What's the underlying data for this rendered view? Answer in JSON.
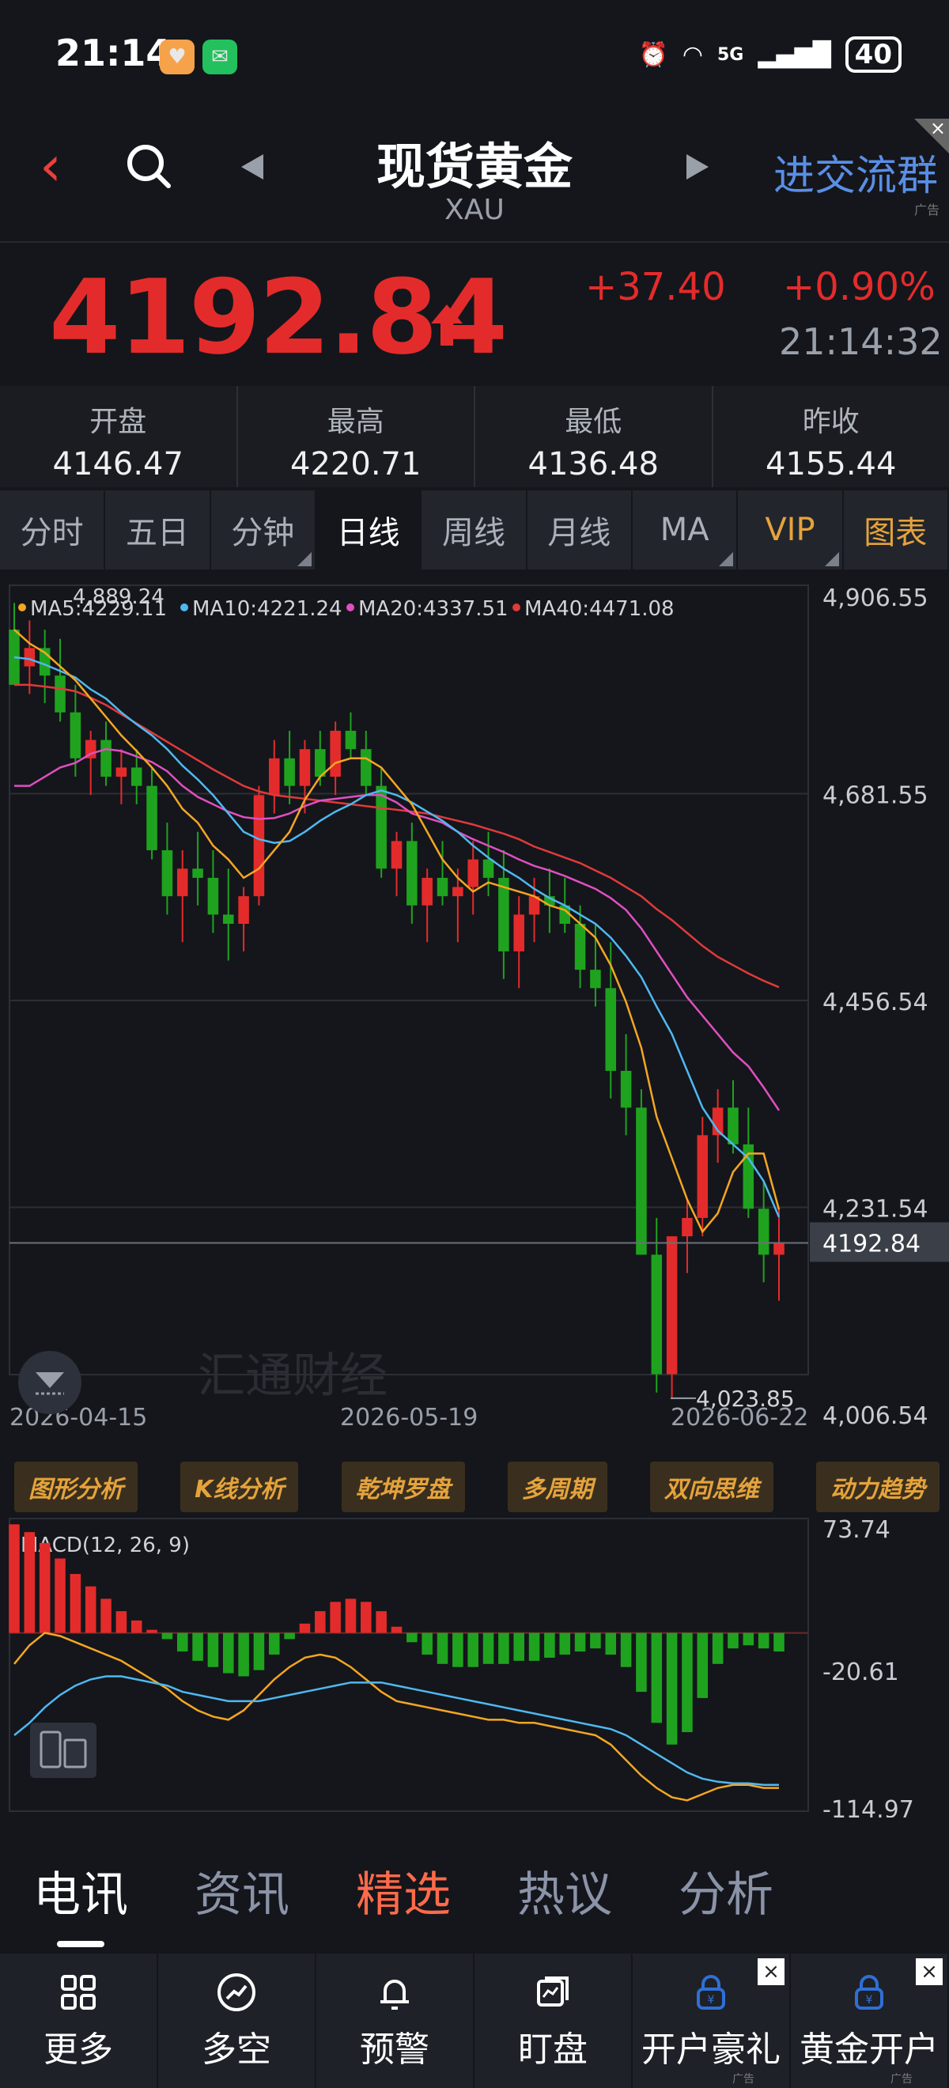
{
  "status": {
    "time": "21:14",
    "network": "5G",
    "battery": "40"
  },
  "header": {
    "title": "现货黄金",
    "subtitle": "XAU",
    "ad_link": "进交流群",
    "ad_tag": "广告"
  },
  "quote": {
    "price": "4192.84",
    "change": "+37.40",
    "change_pct": "+0.90%",
    "time": "21:14:32",
    "up_color": "#e42b2b"
  },
  "stats": [
    {
      "label": "开盘",
      "value": "4146.47"
    },
    {
      "label": "最高",
      "value": "4220.71"
    },
    {
      "label": "最低",
      "value": "4136.48"
    },
    {
      "label": "昨收",
      "value": "4155.44"
    }
  ],
  "tabs": [
    "分时",
    "五日",
    "分钟",
    "日线",
    "周线",
    "月线",
    "MA",
    "VIP",
    "图表"
  ],
  "active_tab": "日线",
  "chart_data": {
    "type": "candlestick",
    "legend": [
      {
        "label": "MA5:4229.11",
        "color": "#f5a623"
      },
      {
        "label": "MA10:4221.24",
        "color": "#4fb8f0"
      },
      {
        "label": "MA20:4337.51",
        "color": "#e04fc0"
      },
      {
        "label": "MA40:4471.08",
        "color": "#e03a3a"
      }
    ],
    "y_ticks": [
      "4,906.55",
      "4,681.55",
      "4,456.54",
      "4,231.54",
      "4,006.54"
    ],
    "ylim": [
      4006.54,
      4906.55
    ],
    "current_price_label": "4192.84",
    "current_price": 4192.84,
    "high_label": "4,889.24",
    "low_label": "4,023.85",
    "x_labels": [
      "2026-04-15",
      "2026-05-19",
      "2026-06-22"
    ],
    "watermark": "汇通财经",
    "up_color": "#e42b2b",
    "down_color": "#1fa31f",
    "candles": [
      [
        4860,
        4889,
        4820,
        4800
      ],
      [
        4820,
        4870,
        4790,
        4840
      ],
      [
        4840,
        4860,
        4780,
        4810
      ],
      [
        4810,
        4850,
        4760,
        4770
      ],
      [
        4770,
        4800,
        4700,
        4720
      ],
      [
        4720,
        4750,
        4680,
        4740
      ],
      [
        4740,
        4760,
        4690,
        4700
      ],
      [
        4700,
        4730,
        4670,
        4710
      ],
      [
        4710,
        4730,
        4670,
        4690
      ],
      [
        4690,
        4710,
        4610,
        4620
      ],
      [
        4620,
        4650,
        4550,
        4570
      ],
      [
        4570,
        4620,
        4520,
        4600
      ],
      [
        4600,
        4640,
        4560,
        4590
      ],
      [
        4590,
        4620,
        4530,
        4550
      ],
      [
        4550,
        4600,
        4500,
        4540
      ],
      [
        4540,
        4580,
        4510,
        4570
      ],
      [
        4570,
        4690,
        4560,
        4680
      ],
      [
        4680,
        4740,
        4660,
        4720
      ],
      [
        4720,
        4750,
        4670,
        4690
      ],
      [
        4690,
        4740,
        4660,
        4730
      ],
      [
        4730,
        4750,
        4690,
        4700
      ],
      [
        4700,
        4760,
        4680,
        4750
      ],
      [
        4750,
        4770,
        4720,
        4730
      ],
      [
        4730,
        4750,
        4680,
        4690
      ],
      [
        4690,
        4710,
        4590,
        4600
      ],
      [
        4600,
        4640,
        4570,
        4630
      ],
      [
        4630,
        4650,
        4540,
        4560
      ],
      [
        4560,
        4600,
        4520,
        4590
      ],
      [
        4590,
        4630,
        4560,
        4570
      ],
      [
        4570,
        4600,
        4520,
        4580
      ],
      [
        4580,
        4630,
        4550,
        4610
      ],
      [
        4610,
        4640,
        4570,
        4590
      ],
      [
        4590,
        4620,
        4480,
        4510
      ],
      [
        4510,
        4570,
        4470,
        4550
      ],
      [
        4550,
        4590,
        4520,
        4570
      ],
      [
        4570,
        4600,
        4530,
        4560
      ],
      [
        4560,
        4590,
        4530,
        4540
      ],
      [
        4540,
        4560,
        4470,
        4490
      ],
      [
        4490,
        4540,
        4450,
        4470
      ],
      [
        4470,
        4520,
        4350,
        4380
      ],
      [
        4380,
        4420,
        4310,
        4340
      ],
      [
        4340,
        4360,
        4180,
        4180
      ],
      [
        4180,
        4220,
        4030,
        4050
      ],
      [
        4050,
        4200,
        4023,
        4200
      ],
      [
        4200,
        4240,
        4160,
        4220
      ],
      [
        4220,
        4330,
        4200,
        4310
      ],
      [
        4310,
        4360,
        4280,
        4340
      ],
      [
        4340,
        4370,
        4290,
        4300
      ],
      [
        4300,
        4340,
        4220,
        4230
      ],
      [
        4230,
        4260,
        4150,
        4180
      ],
      [
        4180,
        4230,
        4130,
        4193
      ]
    ],
    "ma5": [
      4860,
      4845,
      4835,
      4820,
      4805,
      4785,
      4765,
      4745,
      4728,
      4710,
      4690,
      4665,
      4650,
      4625,
      4610,
      4590,
      4600,
      4620,
      4640,
      4675,
      4700,
      4715,
      4720,
      4720,
      4710,
      4690,
      4670,
      4640,
      4610,
      4590,
      4575,
      4585,
      4580,
      4575,
      4570,
      4560,
      4555,
      4540,
      4525,
      4495,
      4455,
      4405,
      4330,
      4285,
      4240,
      4205,
      4225,
      4270,
      4290,
      4290,
      4229
    ],
    "ma10": [
      4830,
      4828,
      4822,
      4815,
      4808,
      4795,
      4785,
      4770,
      4757,
      4745,
      4730,
      4712,
      4697,
      4680,
      4660,
      4640,
      4632,
      4628,
      4630,
      4640,
      4652,
      4662,
      4670,
      4680,
      4685,
      4680,
      4672,
      4662,
      4652,
      4640,
      4625,
      4612,
      4600,
      4590,
      4578,
      4568,
      4560,
      4550,
      4540,
      4525,
      4505,
      4482,
      4450,
      4420,
      4380,
      4340,
      4315,
      4300,
      4285,
      4260,
      4221
    ],
    "ma20": [
      4690,
      4690,
      4700,
      4710,
      4715,
      4725,
      4730,
      4728,
      4722,
      4716,
      4706,
      4690,
      4678,
      4670,
      4662,
      4656,
      4654,
      4655,
      4660,
      4668,
      4674,
      4676,
      4678,
      4680,
      4680,
      4672,
      4660,
      4655,
      4650,
      4640,
      4632,
      4625,
      4618,
      4610,
      4603,
      4598,
      4592,
      4585,
      4578,
      4568,
      4555,
      4535,
      4510,
      4485,
      4460,
      4440,
      4420,
      4400,
      4385,
      4362,
      4337
    ],
    "ma40": [
      4800,
      4800,
      4798,
      4796,
      4793,
      4786,
      4778,
      4768,
      4758,
      4748,
      4738,
      4728,
      4718,
      4708,
      4699,
      4690,
      4684,
      4680,
      4678,
      4676,
      4674,
      4672,
      4670,
      4668,
      4666,
      4664,
      4662,
      4660,
      4656,
      4652,
      4648,
      4643,
      4638,
      4632,
      4624,
      4618,
      4612,
      4606,
      4598,
      4590,
      4580,
      4570,
      4556,
      4544,
      4530,
      4516,
      4504,
      4495,
      4486,
      4478,
      4471
    ]
  },
  "analysis_buttons": [
    "图形分析",
    "K线分析",
    "乾坤罗盘",
    "多周期",
    "双向思维",
    "动力趋势"
  ],
  "macd_data": {
    "title": "MACD(12, 26, 9)",
    "y_ticks": [
      "73.74",
      "-20.61",
      "-114.97"
    ],
    "ylim": [
      -114.97,
      73.74
    ],
    "hist": [
      70,
      65,
      58,
      48,
      38,
      30,
      22,
      14,
      8,
      2,
      -4,
      -12,
      -18,
      -22,
      -26,
      -28,
      -24,
      -14,
      -4,
      6,
      14,
      20,
      22,
      20,
      14,
      4,
      -6,
      -14,
      -20,
      -22,
      -22,
      -20,
      -20,
      -18,
      -18,
      -16,
      -14,
      -12,
      -10,
      -14,
      -22,
      -38,
      -58,
      -72,
      -64,
      -42,
      -20,
      -10,
      -8,
      -10,
      -12
    ],
    "dif": [
      -20,
      -8,
      0,
      -2,
      -6,
      -10,
      -14,
      -18,
      -24,
      -30,
      -36,
      -44,
      -50,
      -54,
      -56,
      -50,
      -40,
      -30,
      -22,
      -16,
      -14,
      -16,
      -22,
      -30,
      -38,
      -44,
      -46,
      -48,
      -50,
      -52,
      -54,
      -56,
      -56,
      -58,
      -58,
      -60,
      -62,
      -64,
      -66,
      -72,
      -82,
      -92,
      -100,
      -106,
      -108,
      -104,
      -100,
      -98,
      -98,
      -100,
      -100
    ],
    "dea": [
      -66,
      -58,
      -48,
      -40,
      -34,
      -30,
      -28,
      -28,
      -30,
      -32,
      -34,
      -38,
      -40,
      -42,
      -44,
      -44,
      -44,
      -42,
      -40,
      -38,
      -36,
      -34,
      -32,
      -32,
      -32,
      -34,
      -36,
      -38,
      -40,
      -42,
      -44,
      -46,
      -48,
      -50,
      -52,
      -54,
      -56,
      -58,
      -60,
      -62,
      -66,
      -72,
      -78,
      -84,
      -90,
      -94,
      -96,
      -97,
      -97,
      -98,
      -98
    ],
    "up_color": "#e42b2b",
    "down_color": "#1fa31f"
  },
  "news_tabs": [
    "电讯",
    "资讯",
    "精选",
    "热议",
    "分析"
  ],
  "bottom_bar": [
    {
      "label": "更多",
      "icon": "grid-icon"
    },
    {
      "label": "多空",
      "icon": "trend-icon"
    },
    {
      "label": "预警",
      "icon": "bell-icon"
    },
    {
      "label": "盯盘",
      "icon": "watch-icon"
    },
    {
      "label": "开户豪礼",
      "icon": "lock-icon",
      "ad": "广告"
    },
    {
      "label": "黄金开户",
      "icon": "lock-icon",
      "ad": "广告"
    }
  ]
}
